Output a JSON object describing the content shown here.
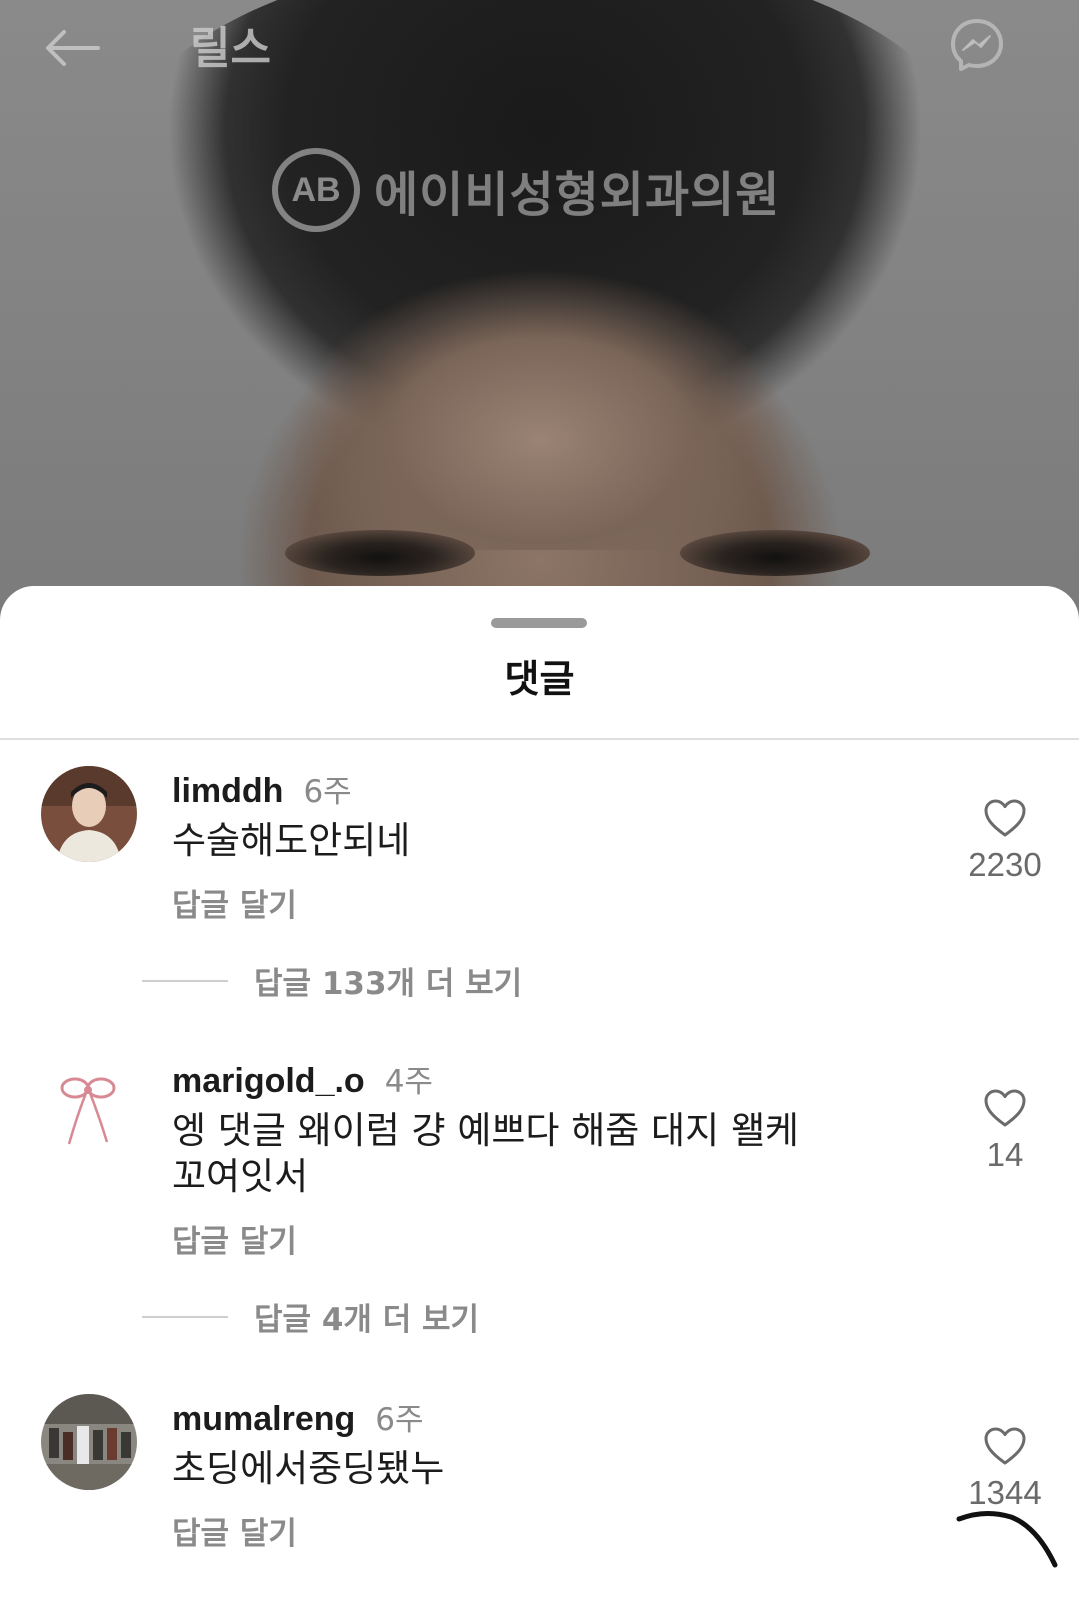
{
  "header": {
    "title": "릴스",
    "watermark_logo": "AB",
    "watermark_text": "에이비성형외과의원"
  },
  "sheet": {
    "title": "댓글"
  },
  "comments": [
    {
      "username": "limddh",
      "time": "6주",
      "text": "수술해도안되네",
      "reply_label": "답글 달기",
      "more_replies": "답글 133개 더 보기",
      "likes": "2230"
    },
    {
      "username": "marigold_.o",
      "time": "4주",
      "text": "엥 댓글 왜이럼 걍 예쁘다 해줌 대지 왤케 꼬여잇서",
      "reply_label": "답글 달기",
      "more_replies": "답글 4개 더 보기",
      "likes": "14"
    },
    {
      "username": "mumalreng",
      "time": "6주",
      "text": "초딩에서중딩됐누",
      "reply_label": "답글 달기",
      "likes": "1344"
    }
  ],
  "icons": {
    "back": "arrow-left-icon",
    "messenger": "messenger-icon",
    "like": "heart-outline-icon"
  }
}
